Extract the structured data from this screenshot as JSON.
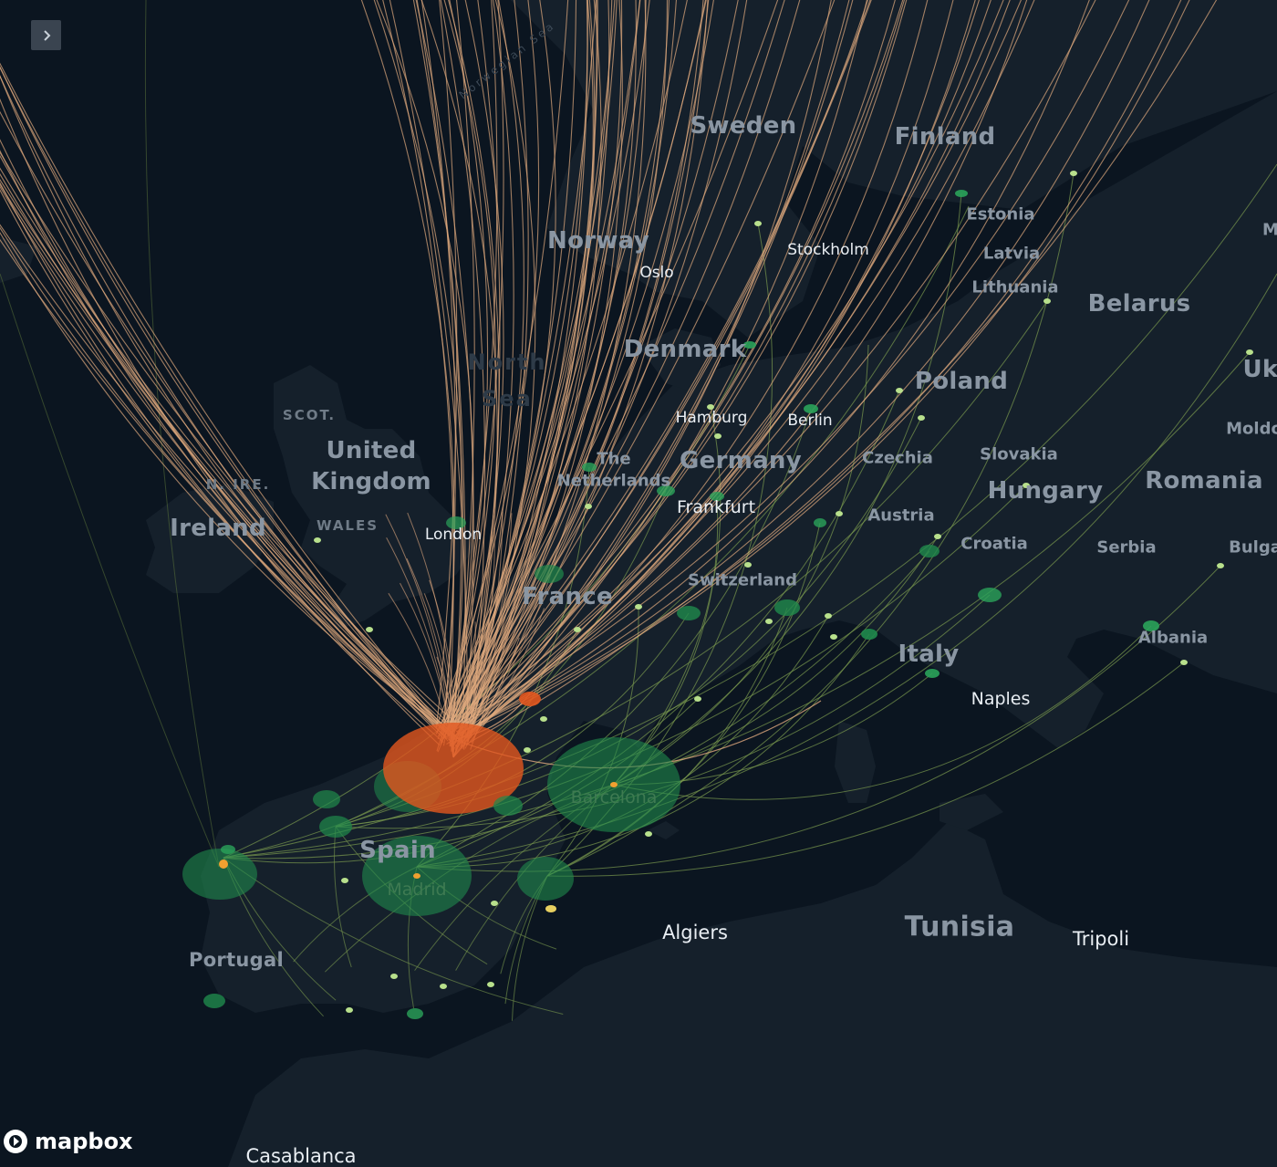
{
  "panel_toggle": {
    "icon": "chevron-right-icon"
  },
  "attribution": {
    "brand": "mapbox",
    "icon": "mapbox-logo-icon"
  },
  "colors": {
    "background": "#0b1520",
    "land": "#15202b",
    "water": "#0b1520",
    "arc_primary": "#e0a97e",
    "arc_secondary": "#7a9a4e",
    "node_green": "#1f8a4c",
    "node_orange": "#e2561e",
    "node_light": "#b8e08c"
  },
  "labels": {
    "countries": {
      "sweden": "Sweden",
      "finland": "Finland",
      "norway": "Norway",
      "denmark": "Denmark",
      "poland": "Poland",
      "belarus": "Belarus",
      "ukraine": "Uk",
      "united": "United",
      "kingdom": "Kingdom",
      "ireland": "Ireland",
      "germany": "Germany",
      "france": "France",
      "hungary": "Hungary",
      "romania": "Romania",
      "italy": "Italy",
      "spain": "Spain",
      "portugal": "Portugal",
      "tunisia": "Tunisia"
    },
    "countries_small": {
      "estonia": "Estonia",
      "latvia": "Latvia",
      "lithuania": "Lithuania",
      "czechia": "Czechia",
      "slovakia": "Slovakia",
      "austria": "Austria",
      "croatia": "Croatia",
      "serbia": "Serbia",
      "albania": "Albania",
      "switzerland": "Switzerland",
      "the": "The",
      "netherlands": "Netherlands",
      "moldova": "Moldo",
      "bulgaria": "Bulga",
      "m_edge": "M"
    },
    "regions": {
      "scotland": "SCOT.",
      "n_ireland": "N. IRE.",
      "wales": "WALES"
    },
    "seas": {
      "north": "North",
      "sea": "Sea",
      "norwegian_sea": "Norwegian Sea"
    },
    "cities": {
      "stockholm": "Stockholm",
      "oslo": "Oslo",
      "hamburg": "Hamburg",
      "berlin": "Berlin",
      "frankfurt": "Frankfurt",
      "london": "London",
      "naples": "Naples",
      "barcelona": "Barcelona",
      "madrid": "Madrid",
      "algiers": "Algiers",
      "tripoli": "Tripoli",
      "casablanca": "Casablanca"
    }
  }
}
